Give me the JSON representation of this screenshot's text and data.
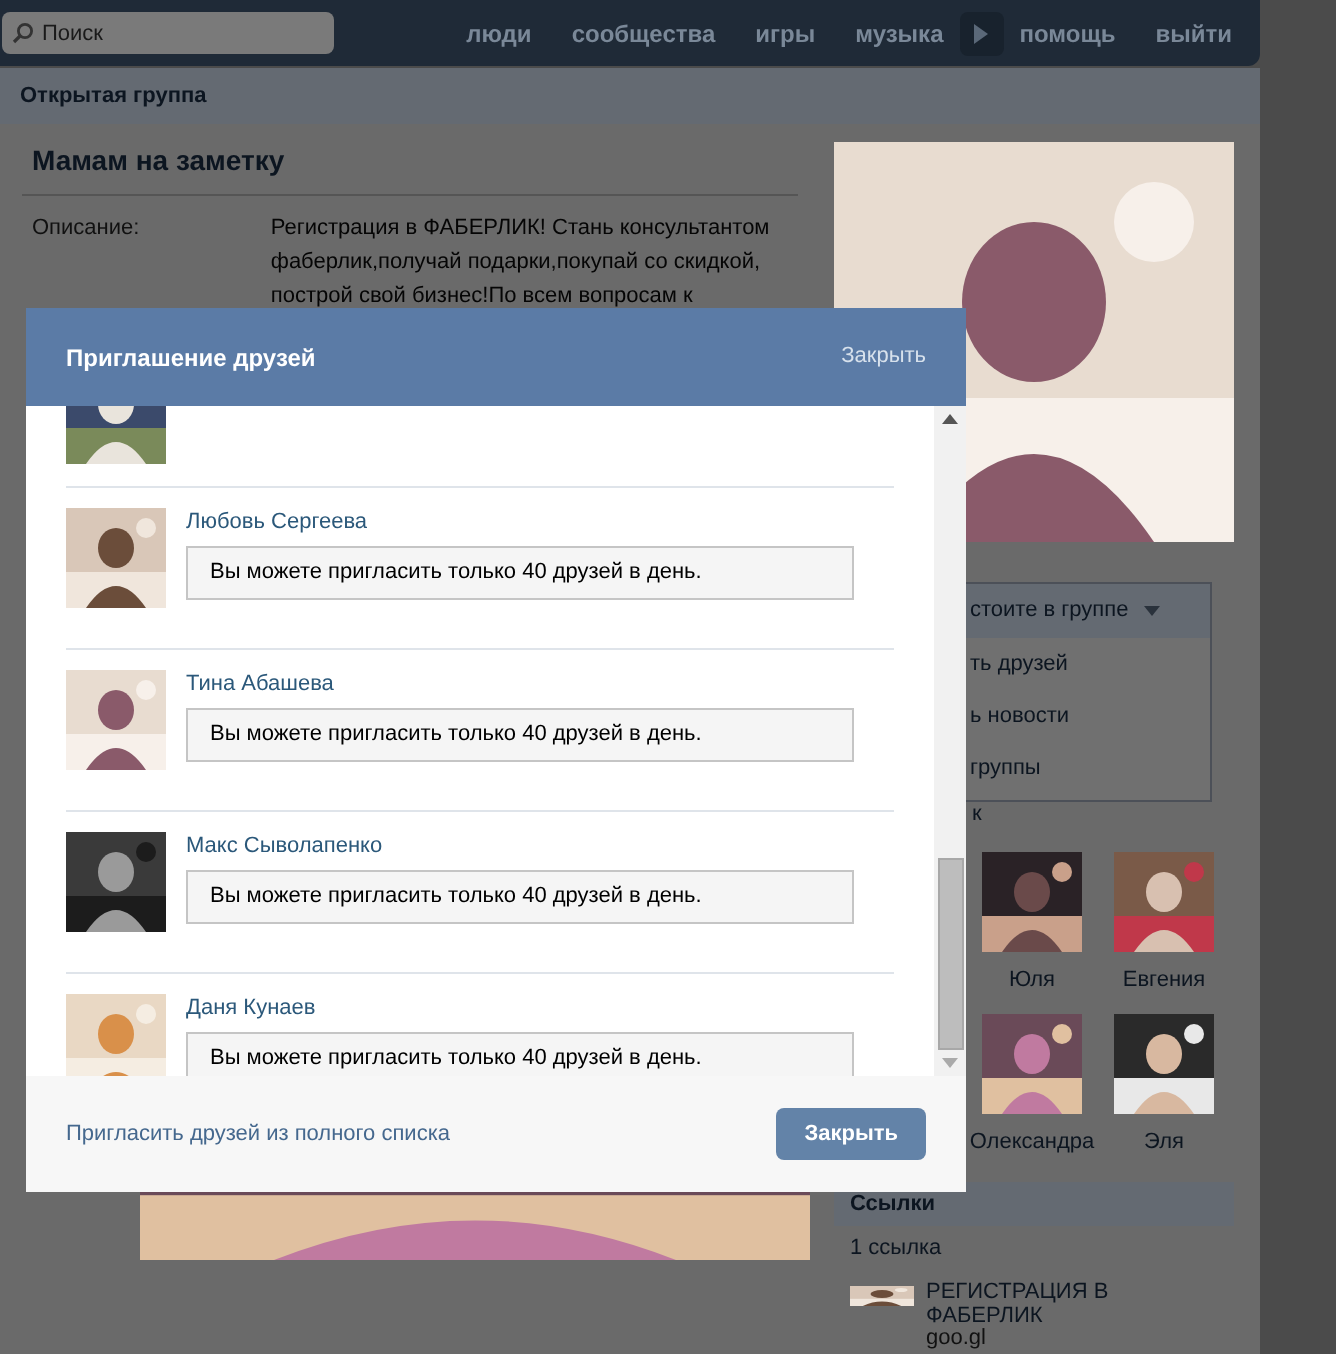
{
  "top_bar": {
    "search": {
      "placeholder": "Поиск"
    },
    "nav": [
      "люди",
      "сообщества",
      "игры",
      "музыка",
      "помощь",
      "выйти"
    ]
  },
  "page": {
    "header": "Открытая группа",
    "group_title": "Мамам на заметку",
    "description_label": "Описание:",
    "description": "Регистрация в ФАБЕРЛИК! Стань консультантом фаберлик,получай подарки,покупай со скидкой, построй свой бизнес!По всем вопросам к",
    "membership": {
      "button": "стоите в группе",
      "items": [
        "ть друзей",
        "ь новости",
        "группы"
      ],
      "fragment": "к"
    },
    "friends": [
      "Юля",
      "Евгения",
      "Олександра",
      "Эля"
    ],
    "links": {
      "title": "Ссылки",
      "count": "1 ссылка",
      "items": [
        {
          "title": "РЕГИСТРАЦИЯ В ФАБЕРЛИК",
          "url": "goo.gl"
        }
      ]
    }
  },
  "dialog": {
    "title": "Приглашение друзей",
    "close_link": "Закрыть",
    "friends": [
      {
        "kind": "partial"
      },
      {
        "kind": "row",
        "name": "Любовь Сергеева",
        "message": "Вы можете пригласить только 40 друзей в день."
      },
      {
        "kind": "row",
        "name": "Тина Абашева",
        "message": "Вы можете пригласить только 40 друзей в день."
      },
      {
        "kind": "row",
        "name": "Макс Сыволапенко",
        "message": "Вы можете пригласить только 40 друзей в день."
      },
      {
        "kind": "row",
        "name": "Даня Кунаев",
        "message": "Вы можете пригласить только 40 друзей в день."
      }
    ],
    "footer_link": "Пригласить друзей из полного списка",
    "close_button": "Закрыть"
  }
}
